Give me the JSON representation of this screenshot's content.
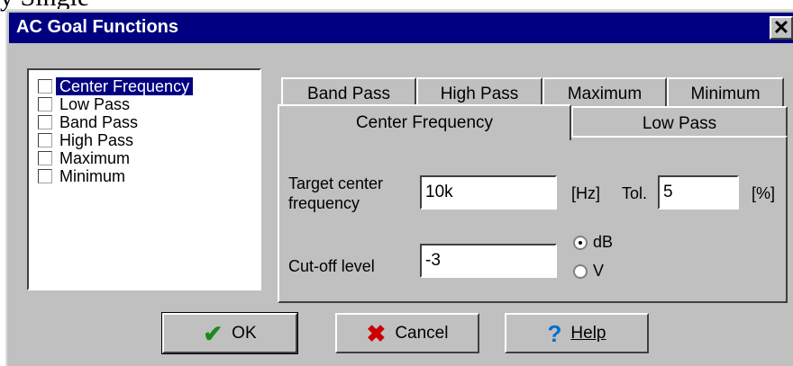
{
  "background_fragment": "y Single",
  "window": {
    "title": "AC Goal Functions",
    "close_glyph": "✕"
  },
  "goal_list": [
    {
      "label": "Center Frequency",
      "checked": false,
      "selected": true
    },
    {
      "label": "Low Pass",
      "checked": false,
      "selected": false
    },
    {
      "label": "Band Pass",
      "checked": false,
      "selected": false
    },
    {
      "label": "High Pass",
      "checked": false,
      "selected": false
    },
    {
      "label": "Maximum",
      "checked": false,
      "selected": false
    },
    {
      "label": "Minimum",
      "checked": false,
      "selected": false
    }
  ],
  "tabs": {
    "back_row": [
      "Band Pass",
      "High Pass",
      "Maximum",
      "Minimum"
    ],
    "front_row": [
      "Center Frequency",
      "Low Pass"
    ],
    "active": "Center Frequency"
  },
  "panel": {
    "target_label_line1": "Target center",
    "target_label_line2": "frequency",
    "target_value": "10k",
    "hz_unit": "[Hz]",
    "tol_label": "Tol.",
    "tol_value": "5",
    "pct_unit": "[%]",
    "cutoff_label": "Cut-off level",
    "cutoff_value": "-3",
    "unit_options": [
      {
        "label": "dB",
        "selected": true
      },
      {
        "label": "V",
        "selected": false
      }
    ]
  },
  "buttons": {
    "ok": "OK",
    "cancel": "Cancel",
    "help": "Help"
  },
  "icons": {
    "ok": "check-icon",
    "cancel": "x-icon",
    "help": "question-icon"
  },
  "colors": {
    "titlebar": "#000080",
    "face": "#c0c0c0",
    "selection": "#000080",
    "ok_icon": "#1a8a1a",
    "cancel_icon": "#cc0000",
    "help_icon": "#0070d0"
  }
}
